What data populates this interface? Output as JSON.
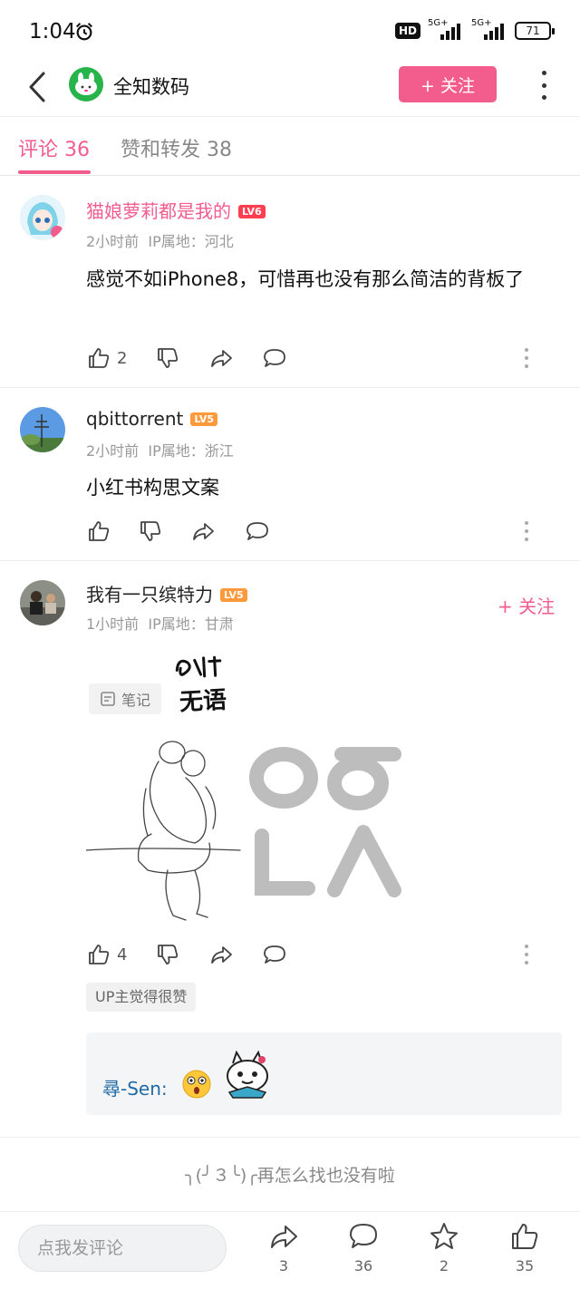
{
  "status_bar": {
    "time": "1:04",
    "hd": "HD",
    "net1": "5G+",
    "net2": "5G+",
    "battery": "71"
  },
  "header": {
    "account_name": "全知数码",
    "follow_label": "+ 关注"
  },
  "tabs": [
    {
      "label": "评论 36",
      "active": true
    },
    {
      "label": "赞和转发 38",
      "active": false
    }
  ],
  "comments": [
    {
      "user": "猫娘萝莉都是我的",
      "level": "LV6",
      "time": "2小时前",
      "location": "IP属地：河北",
      "text": "感觉不如iPhone8，可惜再也没有那么简洁的背板了",
      "likes": "2"
    },
    {
      "user": "qbittorrent",
      "level": "LV5",
      "time": "2小时前",
      "location": "IP属地：浙江",
      "text": "小红书构思文案",
      "likes": ""
    },
    {
      "user": "我有一只缤特力",
      "level": "LV5",
      "time": "1小时前",
      "location": "IP属地：甘肃",
      "follow_label": "+ 关注",
      "note_tag": "笔记",
      "sticker_text": "无语",
      "likes": "4",
      "up_tag": "UP主觉得很赞",
      "reply_name": "尋-Sen:"
    }
  ],
  "end_text": "╮(╯３╰)╭再怎么找也没有啦",
  "bottom_bar": {
    "input_placeholder": "点我发评论",
    "share_count": "3",
    "comment_count": "36",
    "favorite_count": "2",
    "like_count": "35"
  },
  "colors": {
    "accent": "#f25d8e",
    "reply_name": "#1f6aa5"
  }
}
